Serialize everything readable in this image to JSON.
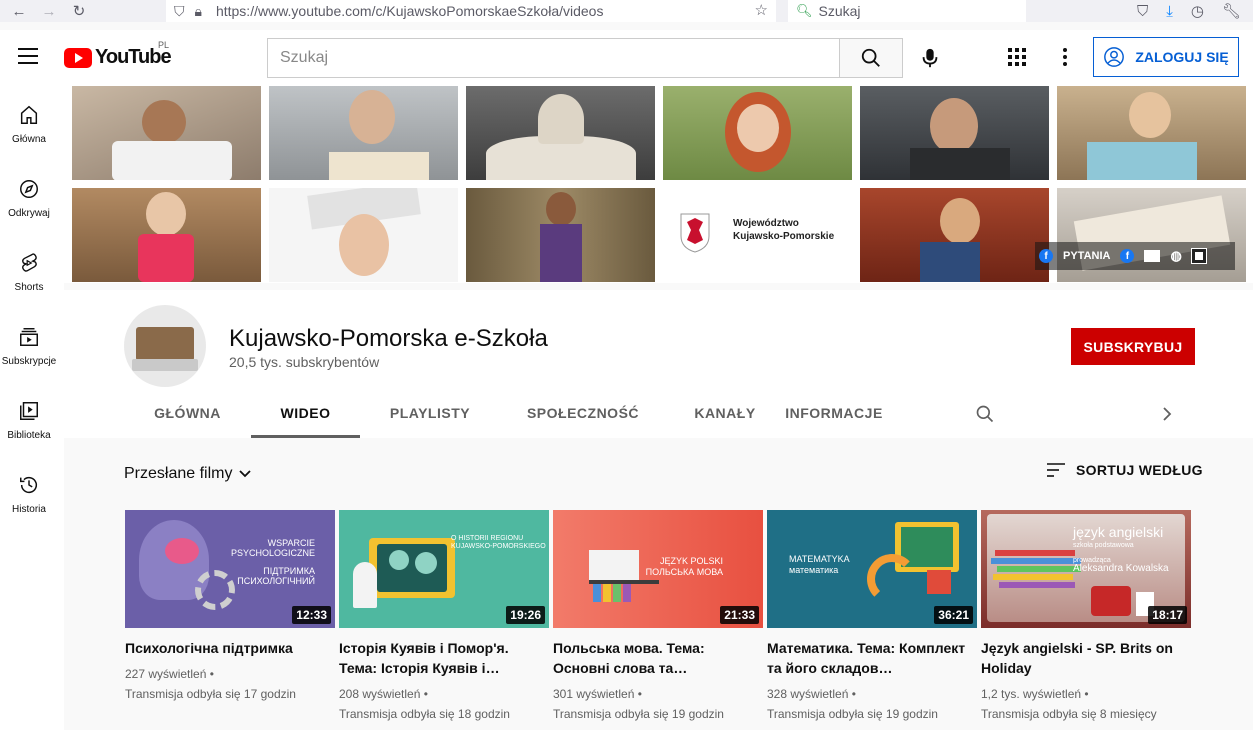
{
  "browser": {
    "url": "https://www.youtube.com/c/KujawskoPomorskaeSzkoła/videos",
    "search_placeholder": "Szukaj"
  },
  "header": {
    "logo_text": "YouTube",
    "country_code": "PL",
    "search_placeholder": "Szukaj",
    "signin_label": "ZALOGUJ SIĘ"
  },
  "nav": {
    "items": [
      {
        "label": "Główna",
        "icon": "home-icon"
      },
      {
        "label": "Odkrywaj",
        "icon": "compass-icon"
      },
      {
        "label": "Shorts",
        "icon": "shorts-icon"
      },
      {
        "label": "Subskrypcje",
        "icon": "subscriptions-icon"
      },
      {
        "label": "Biblioteka",
        "icon": "library-icon"
      },
      {
        "label": "Historia",
        "icon": "history-icon"
      }
    ]
  },
  "banner": {
    "logo_line1": "Województwo",
    "logo_line2": "Kujawsko-Pomorskie",
    "social_label": "PYTANIA"
  },
  "channel": {
    "name": "Kujawsko-Pomorska e-Szkoła",
    "subscribers": "20,5 tys. subskrybentów",
    "subscribe_label": "SUBSKRYBUJ",
    "tabs": [
      "GŁÓWNA",
      "WIDEO",
      "PLAYLISTY",
      "SPOŁECZNOŚĆ",
      "KANAŁY",
      "INFORMACJE"
    ],
    "active_tab": "WIDEO"
  },
  "videos_section": {
    "title": "Przesłane filmy",
    "sort_label": "SORTUJ WEDŁUG"
  },
  "videos": [
    {
      "title": "Психологічна підтримка",
      "duration": "12:33",
      "views": "227 wyświetleń",
      "streamed": "Transmisja odbyła się 17 godzin",
      "thumb_line1": "WSPARCIE",
      "thumb_line2": "PSYCHOLOGICZNE",
      "thumb_line3": "ПІДТРИМКА",
      "thumb_line4": "ПСИХОЛОГІЧНИЙ",
      "bg": "#6b5fa8"
    },
    {
      "title": "Історія Куявів і Помор'я. Тема: Історія Куявів і…",
      "duration": "19:26",
      "views": "208 wyświetleń",
      "streamed": "Transmisja odbyła się 18 godzin",
      "thumb_line1": "O HISTORII REGIONU",
      "thumb_line2": "KUJAWSKO-POMORSKIEGO",
      "bg": "#4fb8a0"
    },
    {
      "title": "Польська мова. Тема: Основні слова та…",
      "duration": "21:33",
      "views": "301 wyświetleń",
      "streamed": "Transmisja odbyła się 19 godzin",
      "thumb_line1": "JĘZYK POLSKI",
      "thumb_line2": "ПОЛЬСЬКА МОВА",
      "bg": "#f06a5a"
    },
    {
      "title": "Математика. Тема: Комплект та його складов…",
      "duration": "36:21",
      "views": "328 wyświetleń",
      "streamed": "Transmisja odbyła się 19 godzin",
      "thumb_line1": "MATEMATYKA",
      "thumb_line2": "математика",
      "bg": "#1f6f86"
    },
    {
      "title": "Język angielski - SP. Brits on Holiday",
      "duration": "18:17",
      "views": "1,2 tys. wyświetleń",
      "streamed": "Transmisja odbyła się 8 miesięcy",
      "thumb_line1": "język angielski",
      "thumb_line2": "szkoła podstawowa",
      "thumb_line3": "prowadząca",
      "thumb_line4": "Aleksandra Kowalska",
      "bg": "#8a3a3a"
    }
  ]
}
